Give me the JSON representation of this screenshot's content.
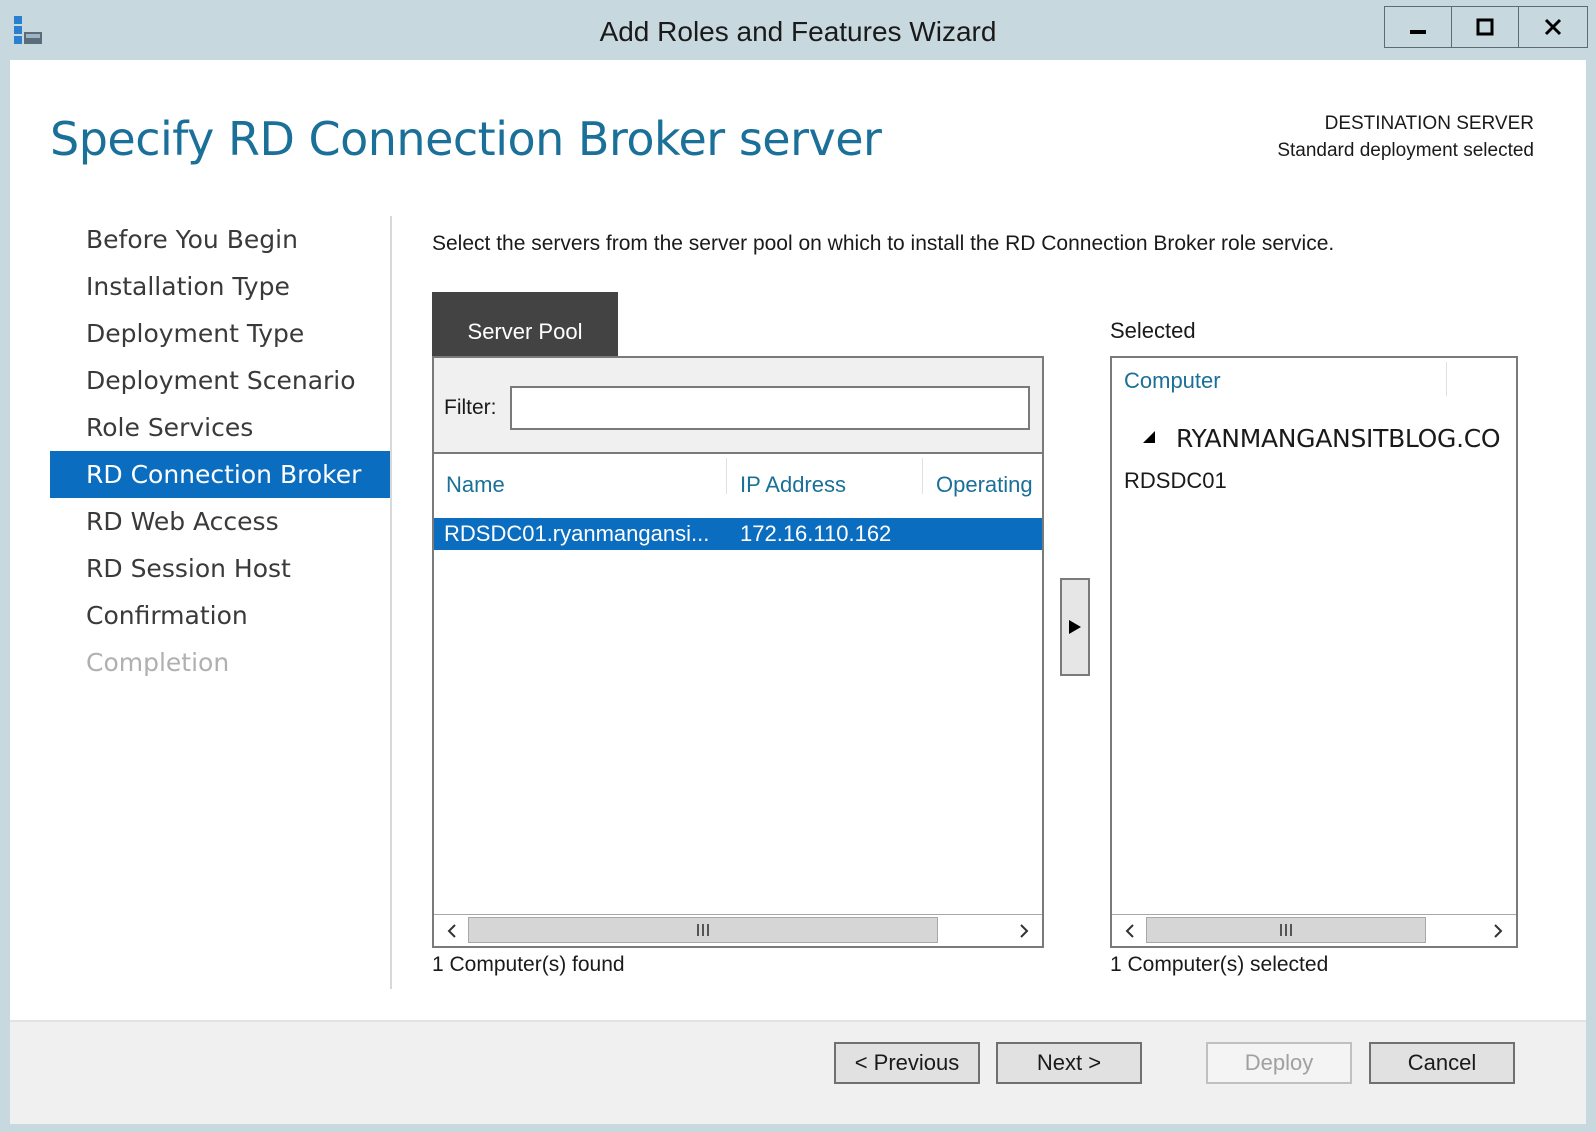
{
  "window": {
    "title": "Add Roles and Features Wizard",
    "controls": {
      "minimize": "minimize",
      "maximize": "maximize",
      "close": "close"
    }
  },
  "header": {
    "page_title": "Specify RD Connection Broker server",
    "destination_label": "DESTINATION SERVER",
    "destination_value": "Standard deployment selected"
  },
  "nav": {
    "items": [
      {
        "label": "Before You Begin",
        "state": "normal"
      },
      {
        "label": "Installation Type",
        "state": "normal"
      },
      {
        "label": "Deployment Type",
        "state": "normal"
      },
      {
        "label": "Deployment Scenario",
        "state": "normal"
      },
      {
        "label": "Role Services",
        "state": "normal"
      },
      {
        "label": "RD Connection Broker",
        "state": "active"
      },
      {
        "label": "RD Web Access",
        "state": "normal"
      },
      {
        "label": "RD Session Host",
        "state": "normal"
      },
      {
        "label": "Confirmation",
        "state": "normal"
      },
      {
        "label": "Completion",
        "state": "disabled"
      }
    ]
  },
  "main": {
    "instruction": "Select the servers from the server pool on which to install the RD Connection Broker role service.",
    "pool_tab": "Server Pool",
    "filter_label": "Filter:",
    "filter_value": "",
    "columns": {
      "name": "Name",
      "ip": "IP Address",
      "os": "Operating"
    },
    "rows": [
      {
        "name": "RDSDC01.ryanmangansi...",
        "ip": "172.16.110.162",
        "selected": true
      }
    ],
    "pool_status": "1 Computer(s) found",
    "selected_label": "Selected",
    "selected_column": "Computer",
    "selected_group": "RYANMANGANSITBLOG.CO",
    "selected_items": [
      "RDSDC01"
    ],
    "selected_status": "1 Computer(s) selected"
  },
  "footer": {
    "previous": "< Previous",
    "next": "Next >",
    "deploy": "Deploy",
    "cancel": "Cancel"
  },
  "colors": {
    "accent": "#0a6dbf",
    "title_text": "#1a7099",
    "tab_dark": "#434343",
    "chrome": "#c7d8df"
  }
}
